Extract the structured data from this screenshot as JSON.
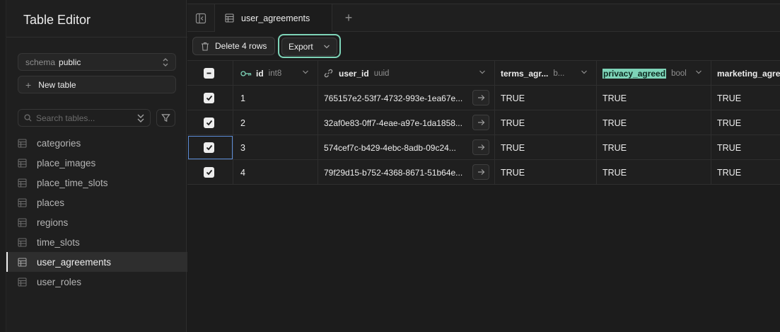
{
  "sidebar": {
    "title": "Table Editor",
    "schema_label": "schema",
    "schema_value": "public",
    "new_table_label": "New table",
    "search_placeholder": "Search tables...",
    "tables": [
      {
        "label": "categories",
        "active": false
      },
      {
        "label": "place_images",
        "active": false
      },
      {
        "label": "place_time_slots",
        "active": false
      },
      {
        "label": "places",
        "active": false
      },
      {
        "label": "regions",
        "active": false
      },
      {
        "label": "time_slots",
        "active": false
      },
      {
        "label": "user_agreements",
        "active": true
      },
      {
        "label": "user_roles",
        "active": false
      }
    ]
  },
  "tabs": {
    "active_tab": "user_agreements"
  },
  "toolbar": {
    "delete_label": "Delete 4 rows",
    "export_label": "Export"
  },
  "grid": {
    "columns": [
      {
        "name": "id",
        "type": "int8"
      },
      {
        "name": "user_id",
        "type": "uuid"
      },
      {
        "name": "terms_agr...",
        "type": "b..."
      },
      {
        "name": "privacy_agreed",
        "type": "bool"
      },
      {
        "name": "marketing_agree",
        "type": ""
      }
    ],
    "rows": [
      {
        "id": "1",
        "user_id": "765157e2-53f7-4732-993e-1ea67e...",
        "terms": "TRUE",
        "privacy": "TRUE",
        "marketing": "TRUE"
      },
      {
        "id": "2",
        "user_id": "32af0e83-0ff7-4eae-a97e-1da1858...",
        "terms": "TRUE",
        "privacy": "TRUE",
        "marketing": "TRUE"
      },
      {
        "id": "3",
        "user_id": "574cef7c-b429-4ebc-8adb-09c24...",
        "terms": "TRUE",
        "privacy": "TRUE",
        "marketing": "TRUE"
      },
      {
        "id": "4",
        "user_id": "79f29d15-b752-4368-8671-51b64e...",
        "terms": "TRUE",
        "privacy": "TRUE",
        "marketing": "TRUE"
      }
    ]
  },
  "colors": {
    "accent": "#7ed4b8",
    "selection": "#5b8bd6",
    "background": "#1c1c1c"
  },
  "icons": {
    "primary_key": "key-icon",
    "foreign_key": "link-icon",
    "table": "table-icon"
  }
}
